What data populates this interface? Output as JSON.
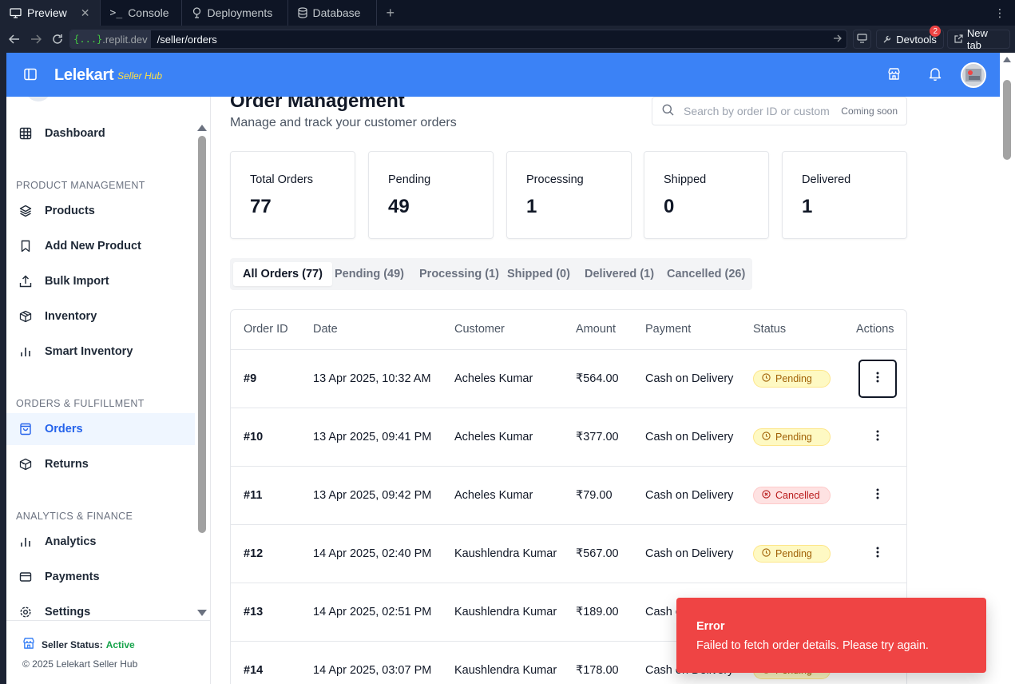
{
  "chrome": {
    "tabs": [
      {
        "label": "Preview",
        "icon": "monitor-icon"
      },
      {
        "label": "Console",
        "icon": "terminal-icon"
      },
      {
        "label": "Deployments",
        "icon": "deploy-icon"
      },
      {
        "label": "Database",
        "icon": "database-icon"
      }
    ],
    "url_domain": "{...}",
    "url_domain_rest": ".replit.dev",
    "url_path": "/seller/orders",
    "devtools_label": "Devtools",
    "devtools_badge": "2",
    "new_tab_label": "New tab"
  },
  "header": {
    "brand": "Lelekart",
    "brand_sub": "Seller Hub",
    "brand_color": "#3b82f6"
  },
  "sidebar": {
    "dashboard": "Dashboard",
    "sections": [
      "PRODUCT MANAGEMENT",
      "ORDERS & FULFILLMENT",
      "ANALYTICS & FINANCE"
    ],
    "product_items": [
      "Products",
      "Add New Product",
      "Bulk Import",
      "Inventory",
      "Smart Inventory"
    ],
    "order_items": [
      "Orders",
      "Returns"
    ],
    "finance_items": [
      "Analytics",
      "Payments",
      "Settings"
    ],
    "active_item": "Orders",
    "status_label": "Seller Status:",
    "status_value": "Active",
    "copyright": "© 2025 Lelekart Seller Hub"
  },
  "page": {
    "title": "Order Management",
    "subtitle": "Manage and track your customer orders",
    "search_placeholder": "Search by order ID or customer",
    "search_hint": "Coming soon"
  },
  "stats": [
    {
      "label": "Total Orders",
      "value": "77"
    },
    {
      "label": "Pending",
      "value": "49"
    },
    {
      "label": "Processing",
      "value": "1"
    },
    {
      "label": "Shipped",
      "value": "0"
    },
    {
      "label": "Delivered",
      "value": "1"
    }
  ],
  "order_tabs": [
    "All Orders (77)",
    "Pending (49)",
    "Processing (1)",
    "Shipped (0)",
    "Delivered (1)",
    "Cancelled (26)"
  ],
  "table": {
    "columns": [
      "Order ID",
      "Date",
      "Customer",
      "Amount",
      "Payment",
      "Status",
      "Actions"
    ],
    "rows": [
      {
        "id": "#9",
        "date": "13 Apr 2025, 10:32 AM",
        "customer": "Acheles Kumar",
        "amount": "₹564.00",
        "payment": "Cash on Delivery",
        "status": "Pending"
      },
      {
        "id": "#10",
        "date": "13 Apr 2025, 09:41 PM",
        "customer": "Acheles Kumar",
        "amount": "₹377.00",
        "payment": "Cash on Delivery",
        "status": "Pending"
      },
      {
        "id": "#11",
        "date": "13 Apr 2025, 09:42 PM",
        "customer": "Acheles Kumar",
        "amount": "₹79.00",
        "payment": "Cash on Delivery",
        "status": "Cancelled"
      },
      {
        "id": "#12",
        "date": "14 Apr 2025, 02:40 PM",
        "customer": "Kaushlendra Kumar",
        "amount": "₹567.00",
        "payment": "Cash on Delivery",
        "status": "Pending"
      },
      {
        "id": "#13",
        "date": "14 Apr 2025, 02:51 PM",
        "customer": "Kaushlendra Kumar",
        "amount": "₹189.00",
        "payment": "Cash on Delivery",
        "status": ""
      },
      {
        "id": "#14",
        "date": "14 Apr 2025, 03:07 PM",
        "customer": "Kaushlendra Kumar",
        "amount": "₹178.00",
        "payment": "Cash on Delivery",
        "status": "Pending"
      }
    ]
  },
  "toast": {
    "title": "Error",
    "message": "Failed to fetch order details. Please try again.",
    "color": "#ef4444"
  }
}
